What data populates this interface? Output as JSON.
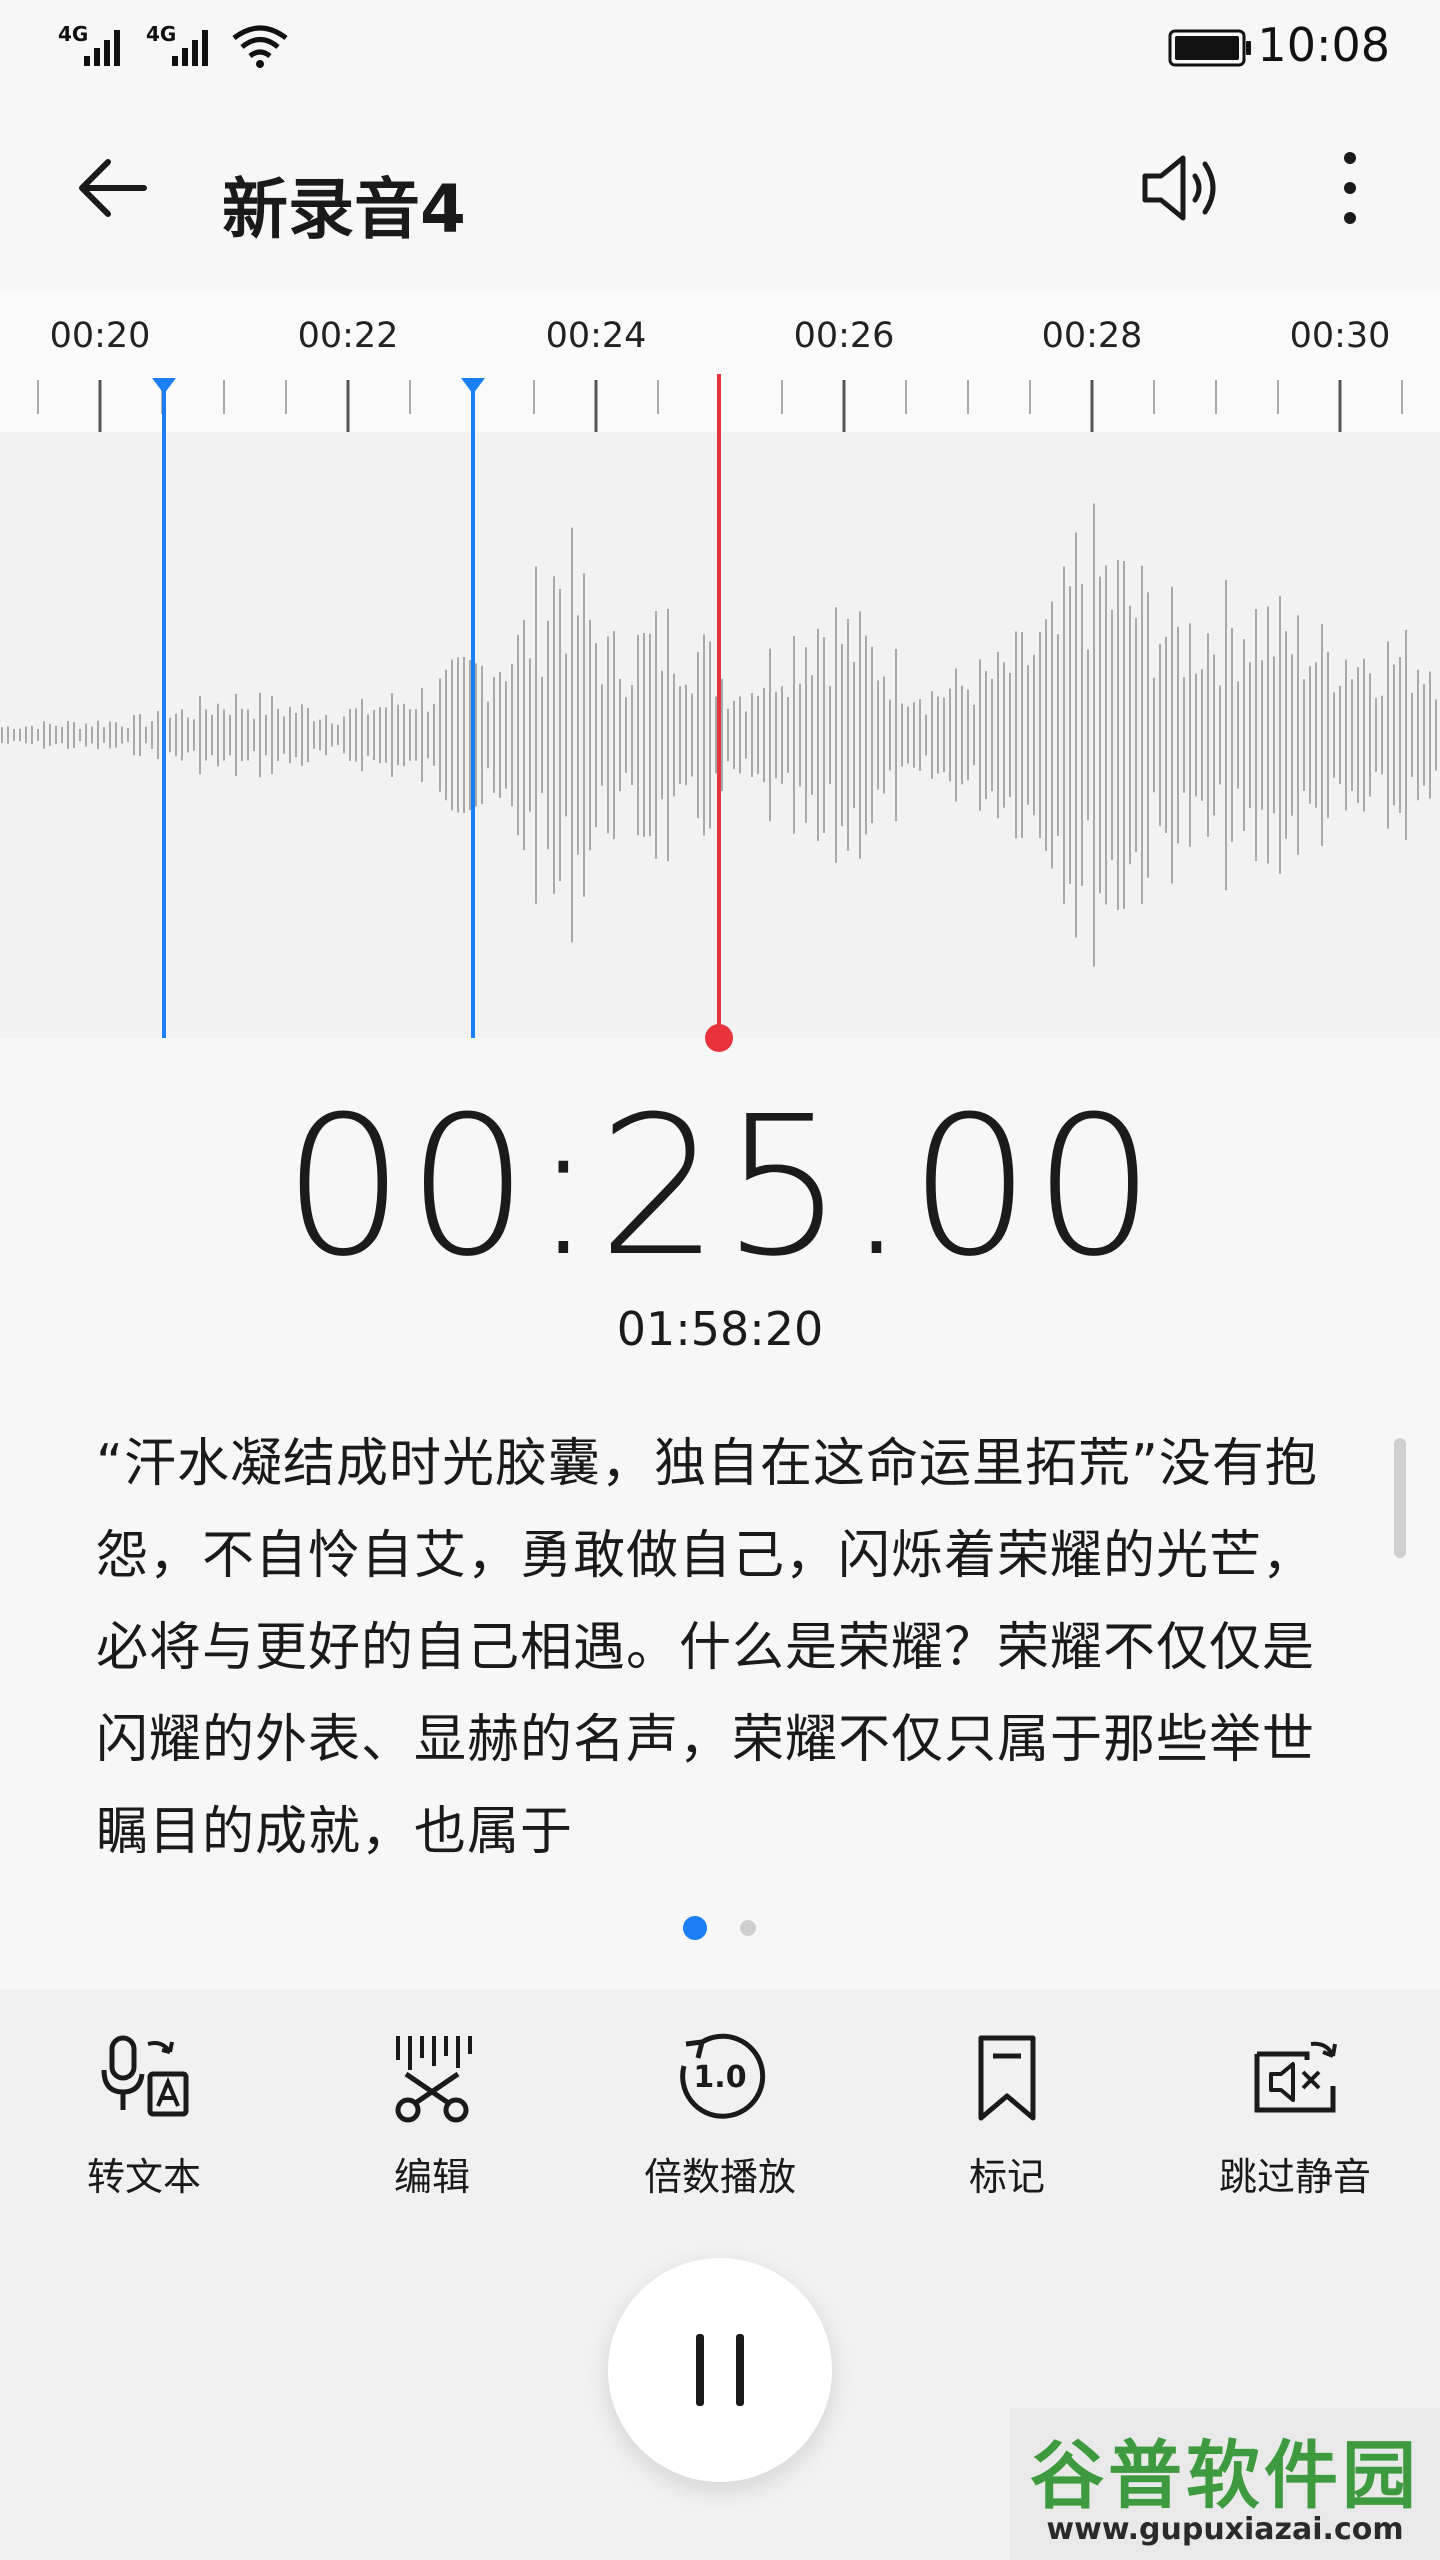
{
  "status_bar": {
    "signal1_label": "4G",
    "signal2_label": "4G",
    "time": "10:08"
  },
  "app_bar": {
    "title": "新录音4",
    "back_icon": "back-arrow-icon",
    "speaker_icon": "speaker-icon",
    "more_icon": "more-vertical-icon"
  },
  "ruler": {
    "labels": [
      "00:20",
      "00:22",
      "00:24",
      "00:26",
      "00:28",
      "00:30"
    ]
  },
  "playback": {
    "current_time": "00:25.00",
    "total_duration": "01:58:20"
  },
  "transcript": {
    "text": "“汗水凝结成时光胶囊，独自在这命运里拓荒”没有抱怨，不自怜自艾，勇敢做自己，闪烁着荣耀的光芒，必将与更好的自己相遇。什么是荣耀？荣耀不仅仅是闪耀的外表、显赫的名声，荣耀不仅只属于那些举世瞩目的成就，也属于"
  },
  "pager": {
    "pages": 2,
    "active": 1
  },
  "toolbar": {
    "items": [
      {
        "label": "转文本",
        "icon": "speech-to-text-icon"
      },
      {
        "label": "编辑",
        "icon": "edit-scissors-icon"
      },
      {
        "label": "倍数播放",
        "icon": "playback-speed-icon",
        "speed_text": "1.0"
      },
      {
        "label": "标记",
        "icon": "bookmark-icon"
      },
      {
        "label": "跳过静音",
        "icon": "skip-silence-icon"
      }
    ]
  },
  "pause_button": {
    "icon": "pause-icon"
  },
  "watermark": {
    "brand": "谷普软件园",
    "url": "www.gupuxiazai.com"
  },
  "colors": {
    "accent_blue": "#1a7ff0",
    "playhead_red": "#e8323c",
    "waveform_gray": "#a9a9a9"
  }
}
